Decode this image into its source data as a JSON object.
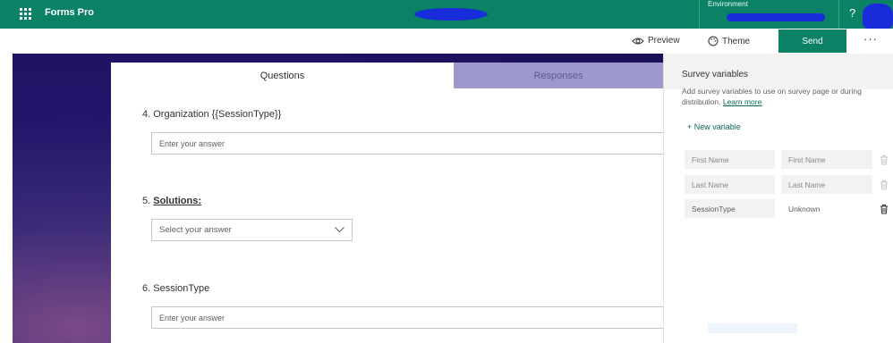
{
  "app": {
    "title": "Forms Pro"
  },
  "environment": {
    "label": "Environment"
  },
  "help": {
    "label": "?"
  },
  "commands": {
    "preview": "Preview",
    "theme": "Theme",
    "send": "Send",
    "more": "···"
  },
  "tabs": {
    "questions": "Questions",
    "responses": "Responses"
  },
  "questions": [
    {
      "number": "4.",
      "title": "Organization {{SessionType}}",
      "placeholder": "Enter your answer"
    },
    {
      "number": "5.",
      "title": "Solutions:",
      "placeholder": "Select your answer"
    },
    {
      "number": "6.",
      "title": "SessionType",
      "placeholder": "Enter your answer"
    }
  ],
  "survey_variables": {
    "title": "Survey variables",
    "description": "Add survey variables to use on survey page or during distribution.",
    "learn_more": "Learn more",
    "new_variable": "+ New variable",
    "rows": [
      {
        "name": "First Name",
        "value": "First Name"
      },
      {
        "name": "Last Name",
        "value": "Last Name"
      },
      {
        "name": "SessionType",
        "value": "Unknown"
      }
    ]
  },
  "colors": {
    "brand": "#0b8265",
    "link": "#0b6a5a",
    "background": "#1a1057"
  }
}
